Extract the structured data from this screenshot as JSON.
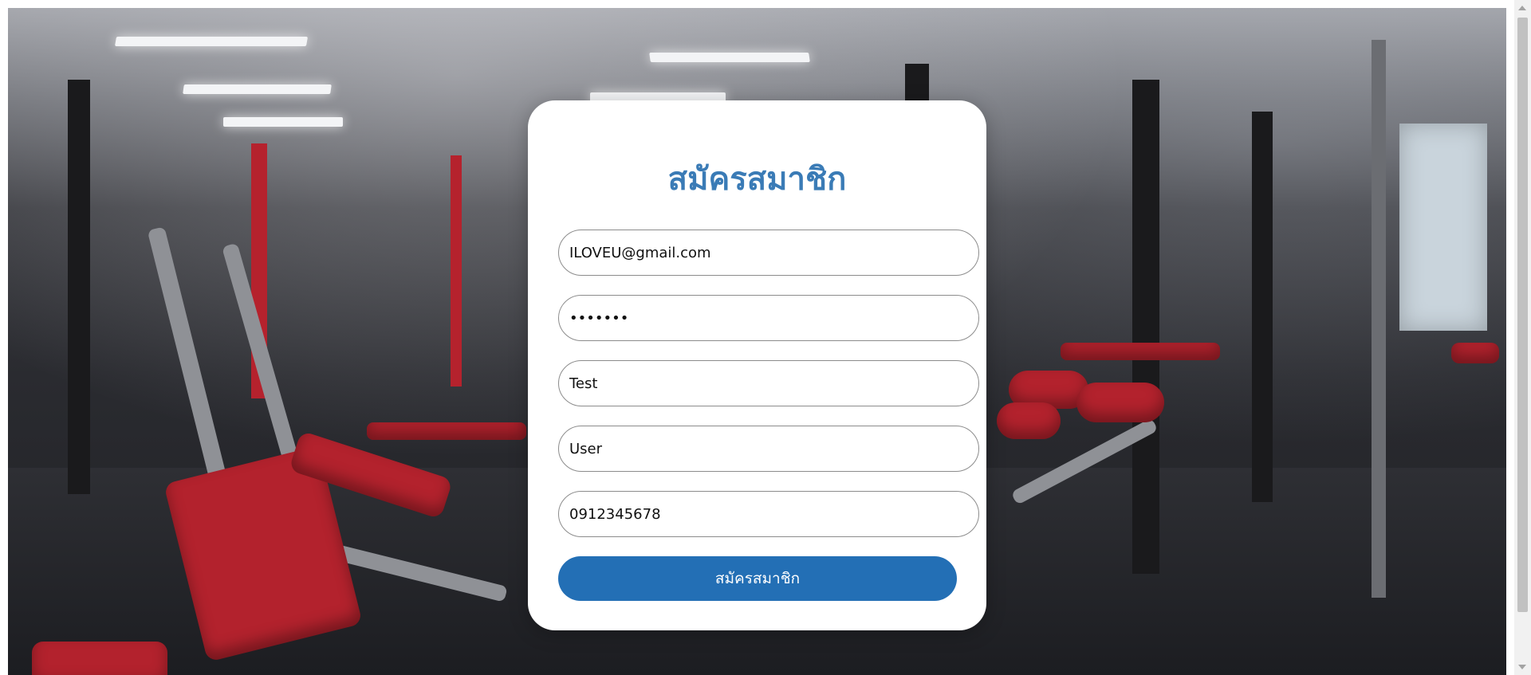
{
  "page": {
    "background": "gym-photo-background"
  },
  "form": {
    "title": "สมัครสมาชิก",
    "fields": {
      "email": {
        "value": "ILOVEU@gmail.com"
      },
      "password": {
        "value": "1234567"
      },
      "first_name": {
        "value": "Test"
      },
      "last_name": {
        "value": "User"
      },
      "phone": {
        "value": "0912345678"
      }
    },
    "submit_label": "สมัครสมาชิก"
  },
  "colors": {
    "title": "#3a7bb6",
    "button": "#236fb5",
    "card": "#ffffff"
  }
}
